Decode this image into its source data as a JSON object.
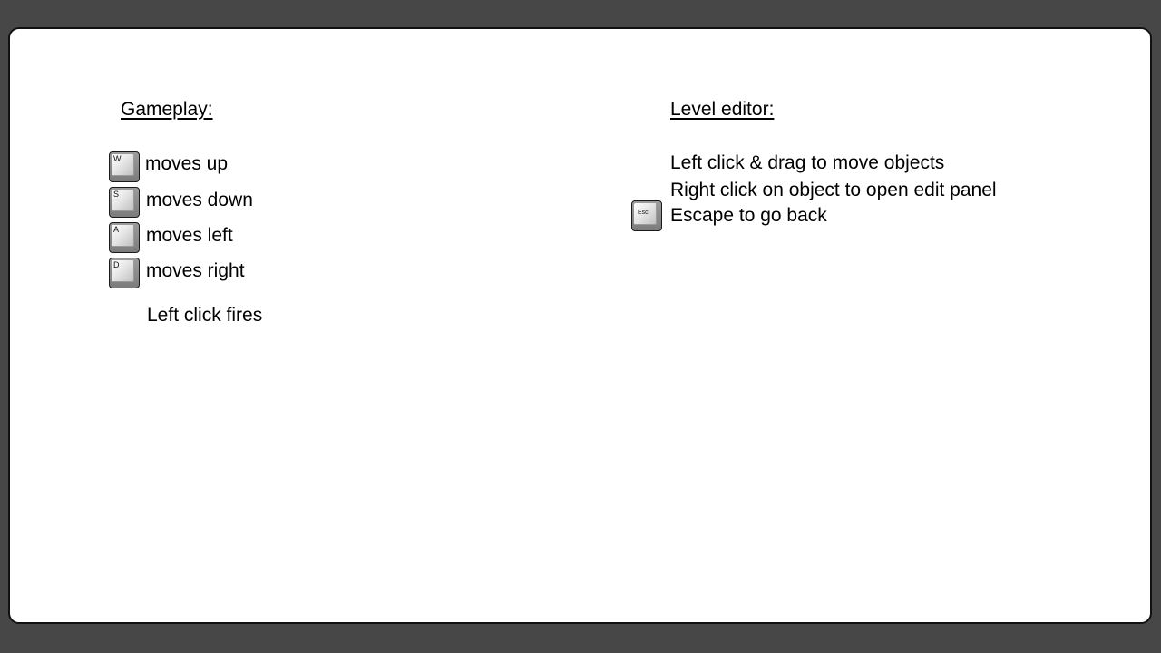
{
  "gameplay": {
    "heading": "Gameplay:",
    "controls": [
      {
        "key": "W",
        "action": "moves up"
      },
      {
        "key": "S",
        "action": "moves down"
      },
      {
        "key": "A",
        "action": "moves left"
      },
      {
        "key": "D",
        "action": "moves right"
      }
    ],
    "fire_text": "Left click fires"
  },
  "editor": {
    "heading": "Level editor:",
    "lines": [
      "Left click & drag to move objects",
      "Right click on object to open edit panel",
      "Escape to go back"
    ],
    "escape_key": "Esc"
  },
  "colors": {
    "background": "#474747",
    "panel": "#ffffff",
    "text": "#000000"
  }
}
